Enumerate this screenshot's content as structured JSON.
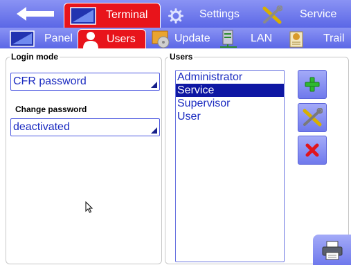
{
  "top_tabs": [
    {
      "label": "Terminal",
      "icon": "terminal-icon",
      "active": true
    },
    {
      "label": "Settings",
      "icon": "gear-icon",
      "active": false
    },
    {
      "label": "Service",
      "icon": "tools-icon",
      "active": false
    }
  ],
  "sub_tabs": [
    {
      "label": "Panel",
      "icon": "panel-icon",
      "active": false
    },
    {
      "label": "Users",
      "icon": "user-icon",
      "active": true
    },
    {
      "label": "Update",
      "icon": "update-icon",
      "active": false
    },
    {
      "label": "LAN",
      "icon": "server-icon",
      "active": false
    },
    {
      "label": "Trail",
      "icon": "audit-trail-icon",
      "active": false
    }
  ],
  "login": {
    "legend": "Login mode",
    "mode_value": "CFR password",
    "change_label": "Change password",
    "change_value": "deactivated"
  },
  "users": {
    "legend": "Users",
    "items": [
      "Administrator",
      "Service",
      "Supervisor",
      "User"
    ],
    "selected": "Service"
  },
  "colors": {
    "accent": "#5b67e6",
    "active_tab": "#e8141b",
    "selection": "#0e17a3",
    "text_blue": "#1a2ac0"
  }
}
